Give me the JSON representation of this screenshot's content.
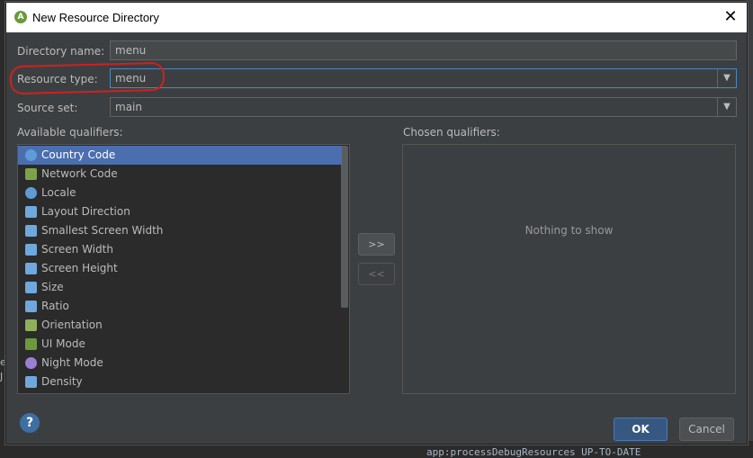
{
  "dialog": {
    "title": "New Resource Directory",
    "close_glyph": "✕"
  },
  "form": {
    "directory_name_label": "Directory name:",
    "directory_name_value": "menu",
    "resource_type_label": "Resource type:",
    "resource_type_value": "menu",
    "source_set_label": "Source set:",
    "source_set_value": "main",
    "dropdown_glyph": "▼"
  },
  "qualifiers": {
    "available_label": "Available qualifiers:",
    "chosen_label": "Chosen qualifiers:",
    "empty_text": "Nothing to show",
    "add_label": ">>",
    "remove_label": "<<",
    "items": [
      {
        "label": "Country Code",
        "icon": "globe-icon",
        "color": "#5f9bd6",
        "selected": true
      },
      {
        "label": "Network Code",
        "icon": "network-icon",
        "color": "#7da34a"
      },
      {
        "label": "Locale",
        "icon": "globe-icon",
        "color": "#5f9bd6"
      },
      {
        "label": "Layout Direction",
        "icon": "layout-direction-icon",
        "color": "#6fa8dc"
      },
      {
        "label": "Smallest Screen Width",
        "icon": "screen-width-icon",
        "color": "#6fa8dc"
      },
      {
        "label": "Screen Width",
        "icon": "screen-width-icon",
        "color": "#6fa8dc"
      },
      {
        "label": "Screen Height",
        "icon": "screen-height-icon",
        "color": "#6fa8dc"
      },
      {
        "label": "Size",
        "icon": "size-icon",
        "color": "#6fa8dc"
      },
      {
        "label": "Ratio",
        "icon": "ratio-icon",
        "color": "#6fa8dc"
      },
      {
        "label": "Orientation",
        "icon": "orientation-icon",
        "color": "#8fb05a"
      },
      {
        "label": "UI Mode",
        "icon": "ui-mode-icon",
        "color": "#6a9a3b"
      },
      {
        "label": "Night Mode",
        "icon": "night-mode-icon",
        "color": "#9b7fd4"
      },
      {
        "label": "Density",
        "icon": "density-icon",
        "color": "#6fa8dc"
      }
    ]
  },
  "buttons": {
    "ok": "OK",
    "cancel": "Cancel",
    "help": "?"
  },
  "background": {
    "log_line": "app:processDebugResources UP-TO-DATE",
    "side_e": "e",
    "side_j": "J"
  }
}
